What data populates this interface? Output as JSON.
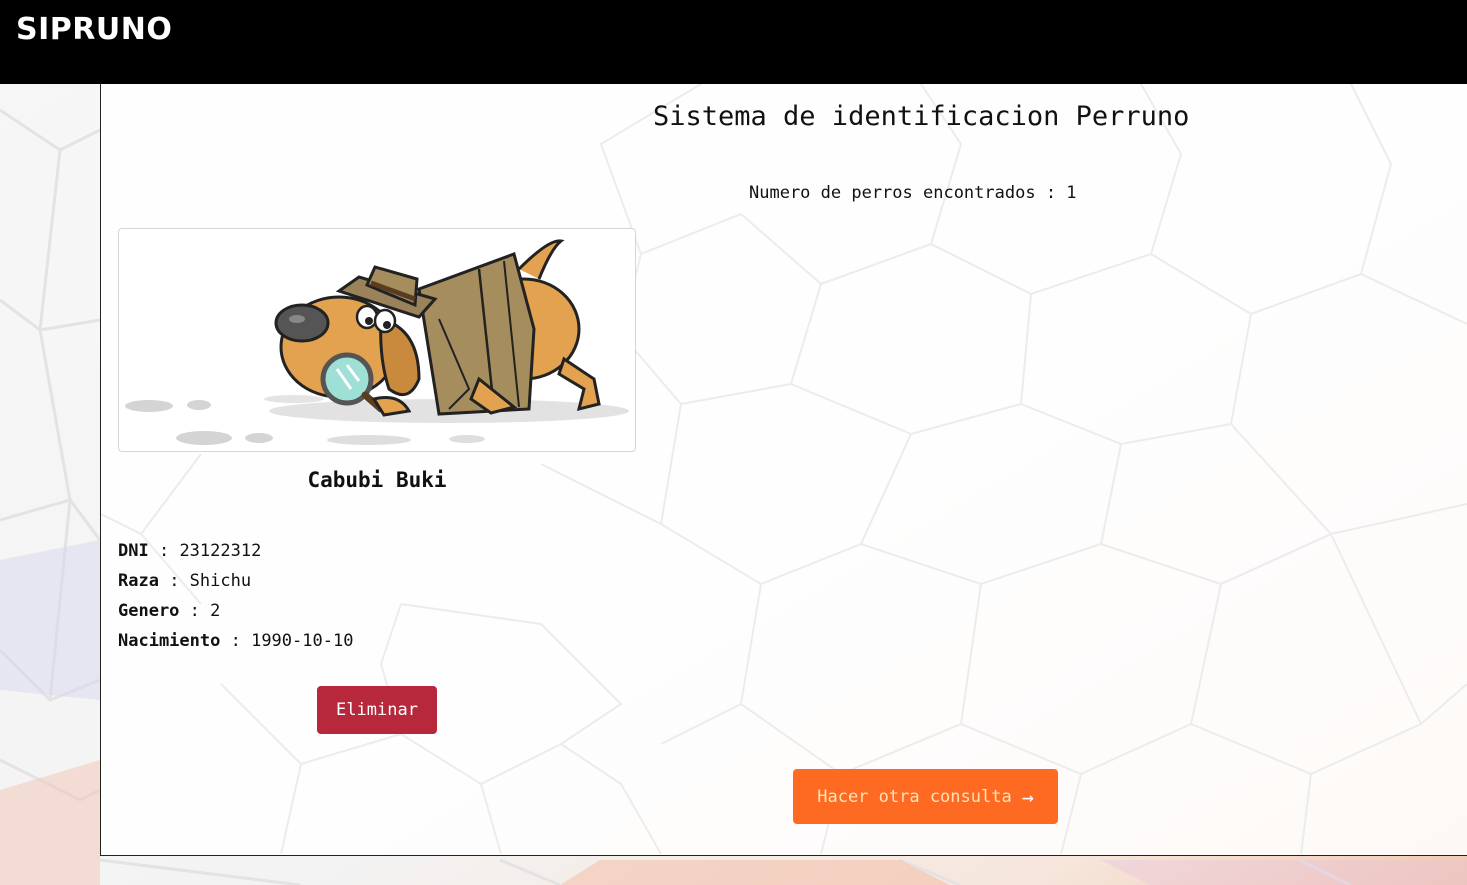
{
  "navbar": {
    "brand": "SIPRUNO"
  },
  "main": {
    "title": "Sistema de identificacion Perruno",
    "count_label": "Numero de perros encontrados",
    "count_value": "1"
  },
  "dog": {
    "name": "Cabubi Buki",
    "image_icon": "detective-dog-illustration",
    "fields": [
      {
        "label": "DNI",
        "value": "23122312"
      },
      {
        "label": "Raza",
        "value": "Shichu"
      },
      {
        "label": "Genero",
        "value": "2"
      },
      {
        "label": "Nacimiento",
        "value": "1990-10-10"
      }
    ],
    "delete_label": "Eliminar"
  },
  "actions": {
    "new_query_label": "Hacer otra consulta",
    "new_query_icon": "arrow-right-icon"
  },
  "colors": {
    "navbar": "#000000",
    "delete_button": "#b8283c",
    "new_query_button": "#ff6a22",
    "new_query_text": "#ffe3b8"
  }
}
